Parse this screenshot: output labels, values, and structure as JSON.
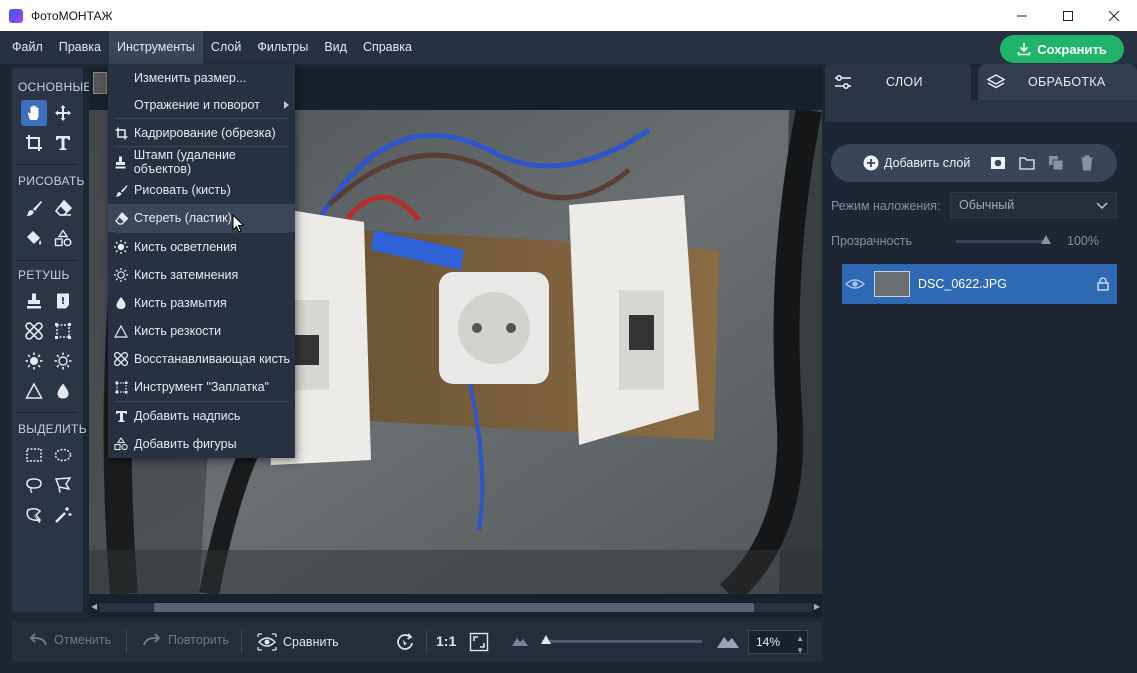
{
  "window": {
    "title": "ФотоМОНТАЖ",
    "minimize": "—",
    "maximize": "☐",
    "close": "✕"
  },
  "menubar": {
    "items": [
      "Файл",
      "Правка",
      "Инструменты",
      "Слой",
      "Фильтры",
      "Вид",
      "Справка"
    ],
    "active_index": 2,
    "save_label": "Сохранить",
    "save_color": "#20b46a"
  },
  "toolbar": {
    "sections": [
      {
        "title": "ОСНОВНЫЕ",
        "tools": [
          "hand-icon",
          "move-icon",
          "crop-icon",
          "text-icon"
        ]
      },
      {
        "title": "РИСОВАТЬ",
        "tools": [
          "brush-icon",
          "eraser-icon",
          "fill-icon",
          "shapes-icon"
        ]
      },
      {
        "title": "РЕТУШЬ",
        "tools": [
          "stamp-icon",
          "healing-icon",
          "restore-brush-icon",
          "patch-icon",
          "lighten-icon",
          "darken-icon",
          "sharpen-icon",
          "blur-icon"
        ]
      },
      {
        "title": "ВЫДЕЛИТЬ",
        "tools": [
          "rect-select-icon",
          "ellipse-select-icon",
          "lasso-icon",
          "polygon-lasso-icon",
          "magnetic-lasso-icon",
          "magic-wand-icon"
        ]
      }
    ],
    "active_tool": "hand-icon"
  },
  "tools_menu": {
    "items": [
      {
        "label": "Изменить размер...",
        "icon": ""
      },
      {
        "label": "Отражение и поворот",
        "icon": "",
        "submenu": true
      },
      {
        "label": "Кадрирование (обрезка)",
        "icon": "crop-icon"
      },
      {
        "label": "Штамп (удаление объектов)",
        "icon": "stamp-icon"
      },
      {
        "label": "Рисовать (кисть)",
        "icon": "brush-icon"
      },
      {
        "label": "Стереть (ластик)",
        "icon": "eraser-icon",
        "hover": true
      },
      {
        "label": "Кисть осветления",
        "icon": "lighten-icon"
      },
      {
        "label": "Кисть затемнения",
        "icon": "darken-icon"
      },
      {
        "label": "Кисть размытия",
        "icon": "blur-icon"
      },
      {
        "label": "Кисть резкости",
        "icon": "sharpen-icon"
      },
      {
        "label": "Восстанавливающая кисть",
        "icon": "restore-brush-icon"
      },
      {
        "label": "Инструмент \"Заплатка\"",
        "icon": "patch-icon"
      },
      {
        "label": "Добавить надпись",
        "icon": "text-icon"
      },
      {
        "label": "Добавить фигуры",
        "icon": "shapes-icon"
      }
    ]
  },
  "bottombar": {
    "undo_label": "Отменить",
    "redo_label": "Повторить",
    "compare_label": "Сравнить",
    "one_to_one": "1:1",
    "zoom_value": "14%",
    "zoom_fraction": 0.02
  },
  "rightpanel": {
    "tabs": [
      {
        "label": "СЛОИ",
        "active": true
      },
      {
        "label": "ОБРАБОТКА",
        "active": false
      }
    ],
    "add_layer_label": "Добавить слой",
    "blend_label": "Режим наложения:",
    "blend_value": "Обычный",
    "opacity_label": "Прозрачность",
    "opacity_value": "100%",
    "opacity_fraction": 1.0,
    "layers": [
      {
        "name": "DSC_0622.JPG",
        "selected": true,
        "visible": true,
        "locked": true
      }
    ]
  }
}
